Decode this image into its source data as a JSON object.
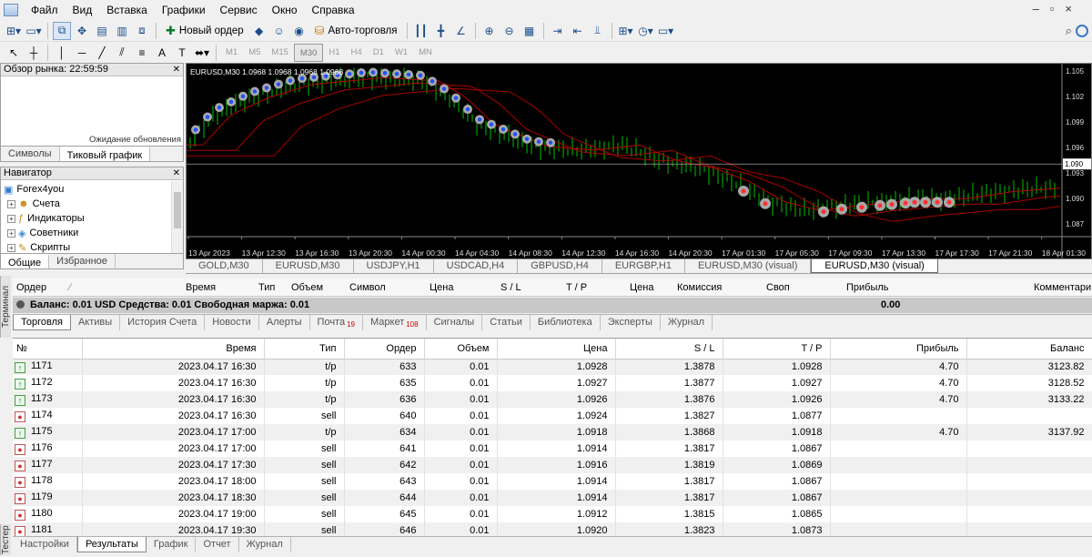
{
  "menu": [
    "Файл",
    "Вид",
    "Вставка",
    "Графики",
    "Сервис",
    "Окно",
    "Справка"
  ],
  "toolbar": {
    "new_order": "Новый ордер",
    "autotrade": "Авто-торговля",
    "timeframes": [
      "M1",
      "M5",
      "M15",
      "M30",
      "H1",
      "H4",
      "D1",
      "W1",
      "MN"
    ],
    "active_timeframe": "M30"
  },
  "market_watch": {
    "title": "Обзор рынка: 22:59:59",
    "waiting": "Ожидание обновления",
    "tabs": [
      "Символы",
      "Тиковый график"
    ],
    "active_tab": "Тиковый график"
  },
  "navigator": {
    "title": "Навигатор",
    "root": "Forex4you",
    "items": [
      "Счета",
      "Индикаторы",
      "Советники",
      "Скрипты"
    ],
    "tabs": [
      "Общие",
      "Избранное"
    ]
  },
  "chart": {
    "label": "EURUSD,M30  1.0968 1.0968 1.0968 1.0968",
    "time_labels": [
      "13 Apr 2023",
      "13 Apr 12:30",
      "13 Apr 16:30",
      "13 Apr 20:30",
      "14 Apr 00:30",
      "14 Apr 04:30",
      "14 Apr 08:30",
      "14 Apr 12:30",
      "14 Apr 16:30",
      "14 Apr 20:30",
      "17 Apr 01:30",
      "17 Apr 05:30",
      "17 Apr 09:30",
      "17 Apr 13:30",
      "17 Apr 17:30",
      "17 Apr 21:30",
      "18 Apr 01:30"
    ],
    "price_labels": [
      "1.105",
      "1.102",
      "1.099",
      "1.096",
      "1.093",
      "1.090",
      "1.087"
    ],
    "current_price": "1.090",
    "colors": {
      "background": "#000000",
      "candle_up": "#00c000",
      "ma": "#c00000",
      "buy_marker": "#1e50ff",
      "sell_marker": "#ff3030",
      "marker_ring": "#a8a8a8"
    }
  },
  "chart_tabs": [
    "GOLD,M30",
    "EURUSD,M30",
    "USDJPY,H1",
    "USDCAD,H4",
    "GBPUSD,H4",
    "EURGBP,H1",
    "EURUSD,M30 (visual)",
    "EURUSD,M30 (visual)"
  ],
  "terminal": {
    "label": "Терминал",
    "columns": [
      "Ордер",
      "Время",
      "Тип",
      "Объем",
      "Символ",
      "Цена",
      "S / L",
      "T / P",
      "Цена",
      "Комиссия",
      "Своп",
      "Прибыль",
      "Комментари"
    ],
    "balance_line": "Баланс: 0.01 USD  Средства: 0.01  Свободная маржа: 0.01",
    "balance_profit": "0.00",
    "tabs": [
      "Торговля",
      "Активы",
      "История Счета",
      "Новости",
      "Алерты",
      "Почта",
      "Маркет",
      "Сигналы",
      "Статьи",
      "Библиотека",
      "Эксперты",
      "Журнал"
    ],
    "mail_count": "19",
    "market_count": "108"
  },
  "results": {
    "columns": [
      "№",
      "Время",
      "Тип",
      "Ордер",
      "Объем",
      "Цена",
      "S / L",
      "T / P",
      "Прибыль",
      "Баланс"
    ],
    "rows": [
      [
        "1171",
        "2023.04.17 16:30",
        "t/p",
        "633",
        "0.01",
        "1.0928",
        "1.3878",
        "1.0928",
        "4.70",
        "3123.82"
      ],
      [
        "1172",
        "2023.04.17 16:30",
        "t/p",
        "635",
        "0.01",
        "1.0927",
        "1.3877",
        "1.0927",
        "4.70",
        "3128.52"
      ],
      [
        "1173",
        "2023.04.17 16:30",
        "t/p",
        "636",
        "0.01",
        "1.0926",
        "1.3876",
        "1.0926",
        "4.70",
        "3133.22"
      ],
      [
        "1174",
        "2023.04.17 16:30",
        "sell",
        "640",
        "0.01",
        "1.0924",
        "1.3827",
        "1.0877",
        "",
        ""
      ],
      [
        "1175",
        "2023.04.17 17:00",
        "t/p",
        "634",
        "0.01",
        "1.0918",
        "1.3868",
        "1.0918",
        "4.70",
        "3137.92"
      ],
      [
        "1176",
        "2023.04.17 17:00",
        "sell",
        "641",
        "0.01",
        "1.0914",
        "1.3817",
        "1.0867",
        "",
        ""
      ],
      [
        "1177",
        "2023.04.17 17:30",
        "sell",
        "642",
        "0.01",
        "1.0916",
        "1.3819",
        "1.0869",
        "",
        ""
      ],
      [
        "1178",
        "2023.04.17 18:00",
        "sell",
        "643",
        "0.01",
        "1.0914",
        "1.3817",
        "1.0867",
        "",
        ""
      ],
      [
        "1179",
        "2023.04.17 18:30",
        "sell",
        "644",
        "0.01",
        "1.0914",
        "1.3817",
        "1.0867",
        "",
        ""
      ],
      [
        "1180",
        "2023.04.17 19:00",
        "sell",
        "645",
        "0.01",
        "1.0912",
        "1.3815",
        "1.0865",
        "",
        ""
      ],
      [
        "1181",
        "2023.04.17 19:30",
        "sell",
        "646",
        "0.01",
        "1.0920",
        "1.3823",
        "1.0873",
        "",
        ""
      ]
    ]
  },
  "tester": {
    "label": "Тестер",
    "tabs": [
      "Настройки",
      "Результаты",
      "График",
      "Отчет",
      "Журнал"
    ],
    "active_tab": "Результаты"
  }
}
